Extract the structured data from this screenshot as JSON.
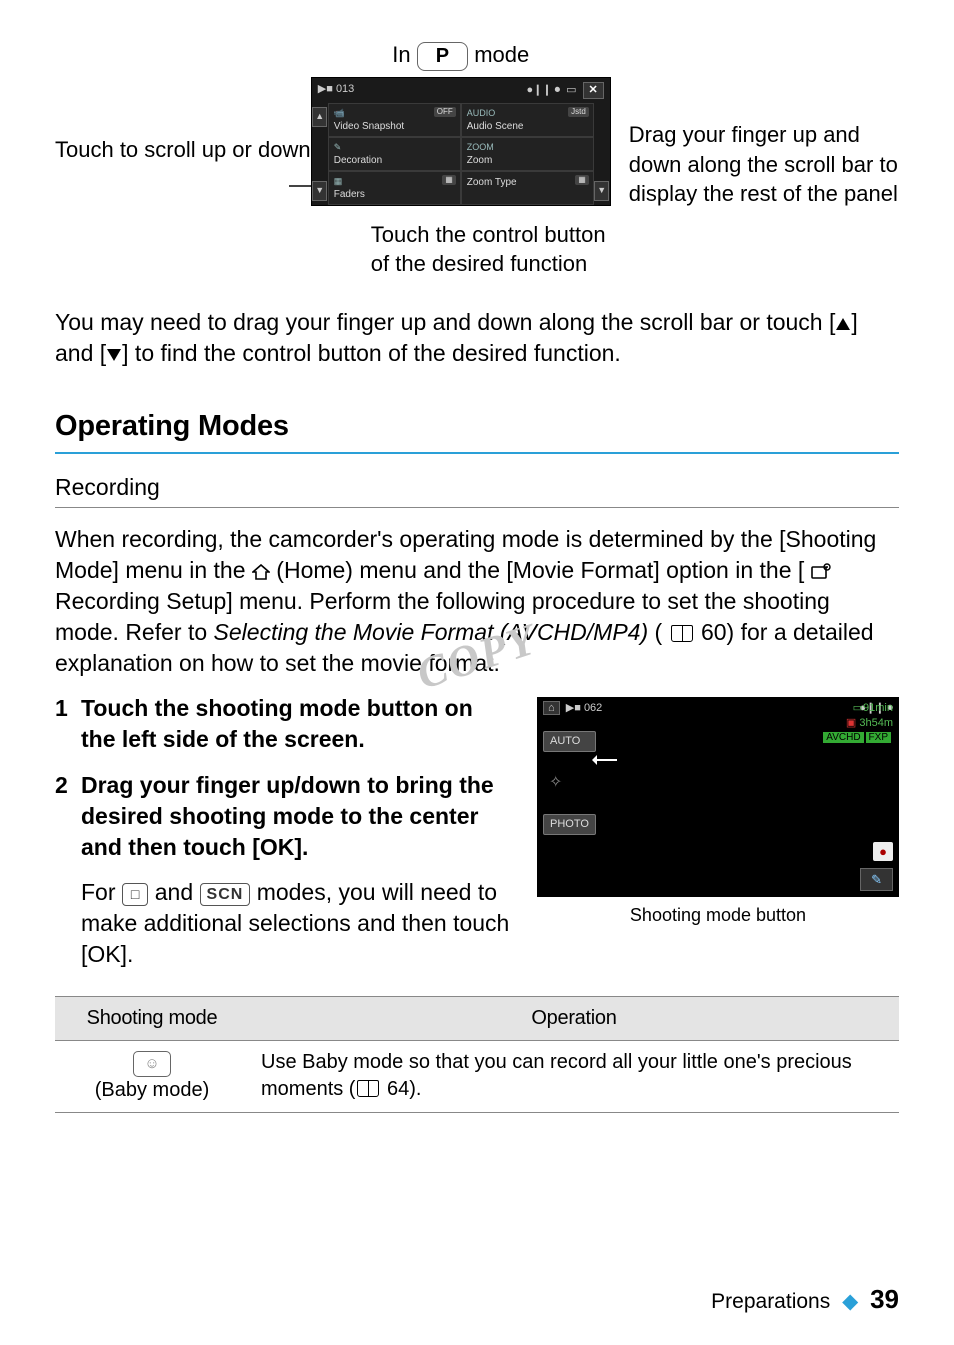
{
  "diagram": {
    "mode_line_prefix": "In ",
    "mode_badge": "P",
    "mode_line_suffix": " mode",
    "left_caption": "Touch to scroll up or down",
    "right_caption": "Drag your finger up and down along the scroll bar to display the rest of the panel",
    "bottom_caption": "Touch the control button of the desired function",
    "panel": {
      "page": "013",
      "close": "✕",
      "rows": [
        {
          "l_badge": "OFF",
          "l_top": "",
          "l_label": "Video Snapshot",
          "r_badge": "Jstd",
          "r_top": "AUDIO",
          "r_label": "Audio Scene"
        },
        {
          "l_badge": "",
          "l_top": "",
          "l_label": "Decoration",
          "r_badge": "",
          "r_top": "ZOOM",
          "r_label": "Zoom"
        },
        {
          "l_badge": "",
          "l_top": "",
          "l_label": "Faders",
          "r_badge": "",
          "r_top": "",
          "r_label": "Zoom Type"
        }
      ]
    }
  },
  "para1_a": "You may need to drag your finger up and down along the scroll bar or touch [",
  "para1_b": "] and [",
  "para1_c": "] to find the control button of the desired function.",
  "heading": "Operating Modes",
  "subhead": "Recording",
  "recording_a": "When recording, the camcorder's operating mode is determined by the [Shooting Mode] menu in the ",
  "recording_b": " (Home) menu and the [Movie Format] option in the [",
  "recording_c": " Recording Setup] menu. Perform the following procedure to set the shooting mode. Refer to ",
  "recording_italic": "Selecting the Movie Format (AVCHD/MP4)",
  "recording_d": " (",
  "recording_pg": " 60) for a detailed explanation on how to set the movie format.",
  "steps": {
    "s1_num": "1",
    "s1": "Touch the shooting mode button on the left side of the screen.",
    "s2_num": "2",
    "s2": "Drag your finger up/down to bring the desired shooting mode to the center and then touch [OK].",
    "s2_sub_a": "For ",
    "s2_sub_b": " and ",
    "s2_sub_c": " modes, you will need to make additional selections and then touch [OK].",
    "scn": "SCN"
  },
  "shot": {
    "page": "062",
    "rec_time": "91min",
    "bat": "3h54m",
    "q1": "AVCHD",
    "q2": "FXP",
    "auto": "AUTO",
    "photo": "PHOTO",
    "caption": "Shooting mode button"
  },
  "table": {
    "h1": "Shooting mode",
    "h2": "Operation",
    "r1_mode": "(Baby mode)",
    "r1_op_a": "Use Baby mode so that you can record all your little one's precious moments (",
    "r1_op_b": " 64)."
  },
  "footer": {
    "section": "Preparations",
    "sep": "◆",
    "page": "39"
  },
  "watermark": "COPY"
}
